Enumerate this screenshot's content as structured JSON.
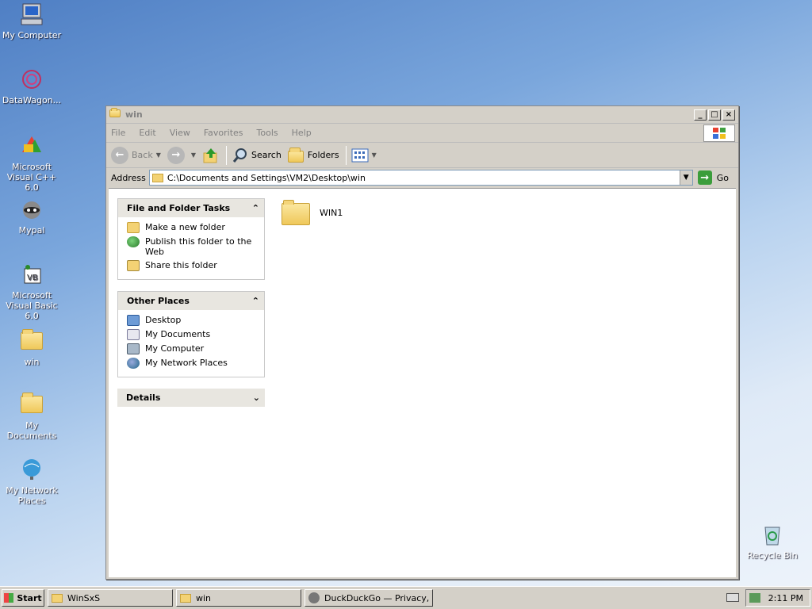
{
  "desktop": {
    "icons": [
      {
        "label": "My Computer"
      },
      {
        "label": "DataWagon..."
      },
      {
        "label": "Microsoft Visual C++ 6.0"
      },
      {
        "label": "Mypal"
      },
      {
        "label": "Microsoft Visual Basic 6.0"
      },
      {
        "label": "win"
      },
      {
        "label": "My Documents"
      },
      {
        "label": "My Network Places"
      },
      {
        "label": "Recycle Bin"
      }
    ]
  },
  "window": {
    "title": "win",
    "menu": [
      "File",
      "Edit",
      "View",
      "Favorites",
      "Tools",
      "Help"
    ],
    "toolbar": {
      "back_label": "Back",
      "search_label": "Search",
      "folders_label": "Folders"
    },
    "address": {
      "label": "Address",
      "value": "C:\\Documents and Settings\\VM2\\Desktop\\win",
      "go_label": "Go"
    },
    "tasks": {
      "file_folder": {
        "title": "File and Folder Tasks",
        "items": [
          "Make a new folder",
          "Publish this folder to the Web",
          "Share this folder"
        ]
      },
      "other_places": {
        "title": "Other Places",
        "items": [
          "Desktop",
          "My Documents",
          "My Computer",
          "My Network Places"
        ]
      },
      "details": {
        "title": "Details"
      }
    },
    "files": [
      {
        "name": "WIN1"
      }
    ]
  },
  "taskbar": {
    "start_label": "Start",
    "tasks": [
      "WinSxS",
      "win",
      "DuckDuckGo — Privacy, ..."
    ],
    "clock": "2:11 PM"
  }
}
